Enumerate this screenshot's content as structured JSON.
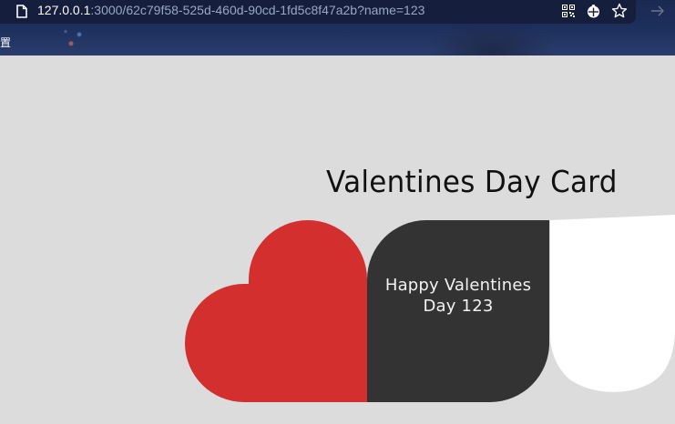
{
  "browser": {
    "left_glyph": "⟩",
    "url_host": "127.0.0.1",
    "url_rest": ":3000/62c79f58-525d-460d-90cd-1fd5c8f47a2b?name=123",
    "bookmark_label": "置",
    "icons": [
      "page-icon",
      "qr-code-icon",
      "extension-bug-icon",
      "bookmark-star-icon",
      "forward-arrow-icon"
    ]
  },
  "card": {
    "title": "Valentines Day Card",
    "message_line1": "Happy Valentines",
    "message_line2": "Day 123"
  },
  "colors": {
    "page_background": "#dcdcdc",
    "heart": "#d32f2f",
    "message_panel": "#333333",
    "message_text": "#f2f2f2",
    "white_panel": "#ffffff"
  }
}
